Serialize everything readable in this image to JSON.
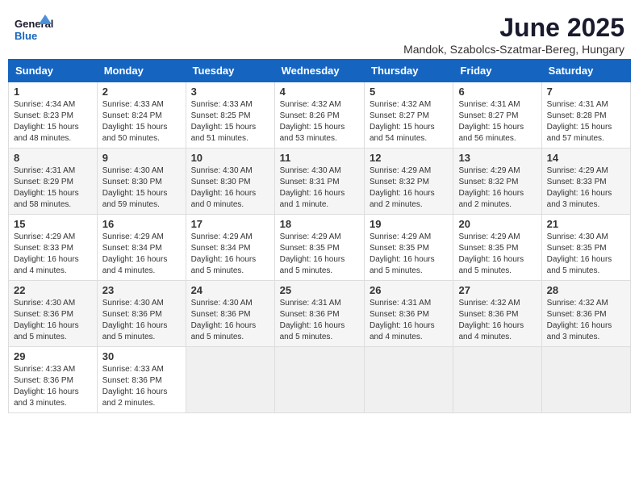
{
  "header": {
    "logo_line1": "General",
    "logo_line2": "Blue",
    "month_title": "June 2025",
    "location": "Mandok, Szabolcs-Szatmar-Bereg, Hungary"
  },
  "weekdays": [
    "Sunday",
    "Monday",
    "Tuesday",
    "Wednesday",
    "Thursday",
    "Friday",
    "Saturday"
  ],
  "weeks": [
    [
      {
        "day": "1",
        "info": "Sunrise: 4:34 AM\nSunset: 8:23 PM\nDaylight: 15 hours\nand 48 minutes."
      },
      {
        "day": "2",
        "info": "Sunrise: 4:33 AM\nSunset: 8:24 PM\nDaylight: 15 hours\nand 50 minutes."
      },
      {
        "day": "3",
        "info": "Sunrise: 4:33 AM\nSunset: 8:25 PM\nDaylight: 15 hours\nand 51 minutes."
      },
      {
        "day": "4",
        "info": "Sunrise: 4:32 AM\nSunset: 8:26 PM\nDaylight: 15 hours\nand 53 minutes."
      },
      {
        "day": "5",
        "info": "Sunrise: 4:32 AM\nSunset: 8:27 PM\nDaylight: 15 hours\nand 54 minutes."
      },
      {
        "day": "6",
        "info": "Sunrise: 4:31 AM\nSunset: 8:27 PM\nDaylight: 15 hours\nand 56 minutes."
      },
      {
        "day": "7",
        "info": "Sunrise: 4:31 AM\nSunset: 8:28 PM\nDaylight: 15 hours\nand 57 minutes."
      }
    ],
    [
      {
        "day": "8",
        "info": "Sunrise: 4:31 AM\nSunset: 8:29 PM\nDaylight: 15 hours\nand 58 minutes."
      },
      {
        "day": "9",
        "info": "Sunrise: 4:30 AM\nSunset: 8:30 PM\nDaylight: 15 hours\nand 59 minutes."
      },
      {
        "day": "10",
        "info": "Sunrise: 4:30 AM\nSunset: 8:30 PM\nDaylight: 16 hours\nand 0 minutes."
      },
      {
        "day": "11",
        "info": "Sunrise: 4:30 AM\nSunset: 8:31 PM\nDaylight: 16 hours\nand 1 minute."
      },
      {
        "day": "12",
        "info": "Sunrise: 4:29 AM\nSunset: 8:32 PM\nDaylight: 16 hours\nand 2 minutes."
      },
      {
        "day": "13",
        "info": "Sunrise: 4:29 AM\nSunset: 8:32 PM\nDaylight: 16 hours\nand 2 minutes."
      },
      {
        "day": "14",
        "info": "Sunrise: 4:29 AM\nSunset: 8:33 PM\nDaylight: 16 hours\nand 3 minutes."
      }
    ],
    [
      {
        "day": "15",
        "info": "Sunrise: 4:29 AM\nSunset: 8:33 PM\nDaylight: 16 hours\nand 4 minutes."
      },
      {
        "day": "16",
        "info": "Sunrise: 4:29 AM\nSunset: 8:34 PM\nDaylight: 16 hours\nand 4 minutes."
      },
      {
        "day": "17",
        "info": "Sunrise: 4:29 AM\nSunset: 8:34 PM\nDaylight: 16 hours\nand 5 minutes."
      },
      {
        "day": "18",
        "info": "Sunrise: 4:29 AM\nSunset: 8:35 PM\nDaylight: 16 hours\nand 5 minutes."
      },
      {
        "day": "19",
        "info": "Sunrise: 4:29 AM\nSunset: 8:35 PM\nDaylight: 16 hours\nand 5 minutes."
      },
      {
        "day": "20",
        "info": "Sunrise: 4:29 AM\nSunset: 8:35 PM\nDaylight: 16 hours\nand 5 minutes."
      },
      {
        "day": "21",
        "info": "Sunrise: 4:30 AM\nSunset: 8:35 PM\nDaylight: 16 hours\nand 5 minutes."
      }
    ],
    [
      {
        "day": "22",
        "info": "Sunrise: 4:30 AM\nSunset: 8:36 PM\nDaylight: 16 hours\nand 5 minutes."
      },
      {
        "day": "23",
        "info": "Sunrise: 4:30 AM\nSunset: 8:36 PM\nDaylight: 16 hours\nand 5 minutes."
      },
      {
        "day": "24",
        "info": "Sunrise: 4:30 AM\nSunset: 8:36 PM\nDaylight: 16 hours\nand 5 minutes."
      },
      {
        "day": "25",
        "info": "Sunrise: 4:31 AM\nSunset: 8:36 PM\nDaylight: 16 hours\nand 5 minutes."
      },
      {
        "day": "26",
        "info": "Sunrise: 4:31 AM\nSunset: 8:36 PM\nDaylight: 16 hours\nand 4 minutes."
      },
      {
        "day": "27",
        "info": "Sunrise: 4:32 AM\nSunset: 8:36 PM\nDaylight: 16 hours\nand 4 minutes."
      },
      {
        "day": "28",
        "info": "Sunrise: 4:32 AM\nSunset: 8:36 PM\nDaylight: 16 hours\nand 3 minutes."
      }
    ],
    [
      {
        "day": "29",
        "info": "Sunrise: 4:33 AM\nSunset: 8:36 PM\nDaylight: 16 hours\nand 3 minutes."
      },
      {
        "day": "30",
        "info": "Sunrise: 4:33 AM\nSunset: 8:36 PM\nDaylight: 16 hours\nand 2 minutes."
      },
      null,
      null,
      null,
      null,
      null
    ]
  ]
}
